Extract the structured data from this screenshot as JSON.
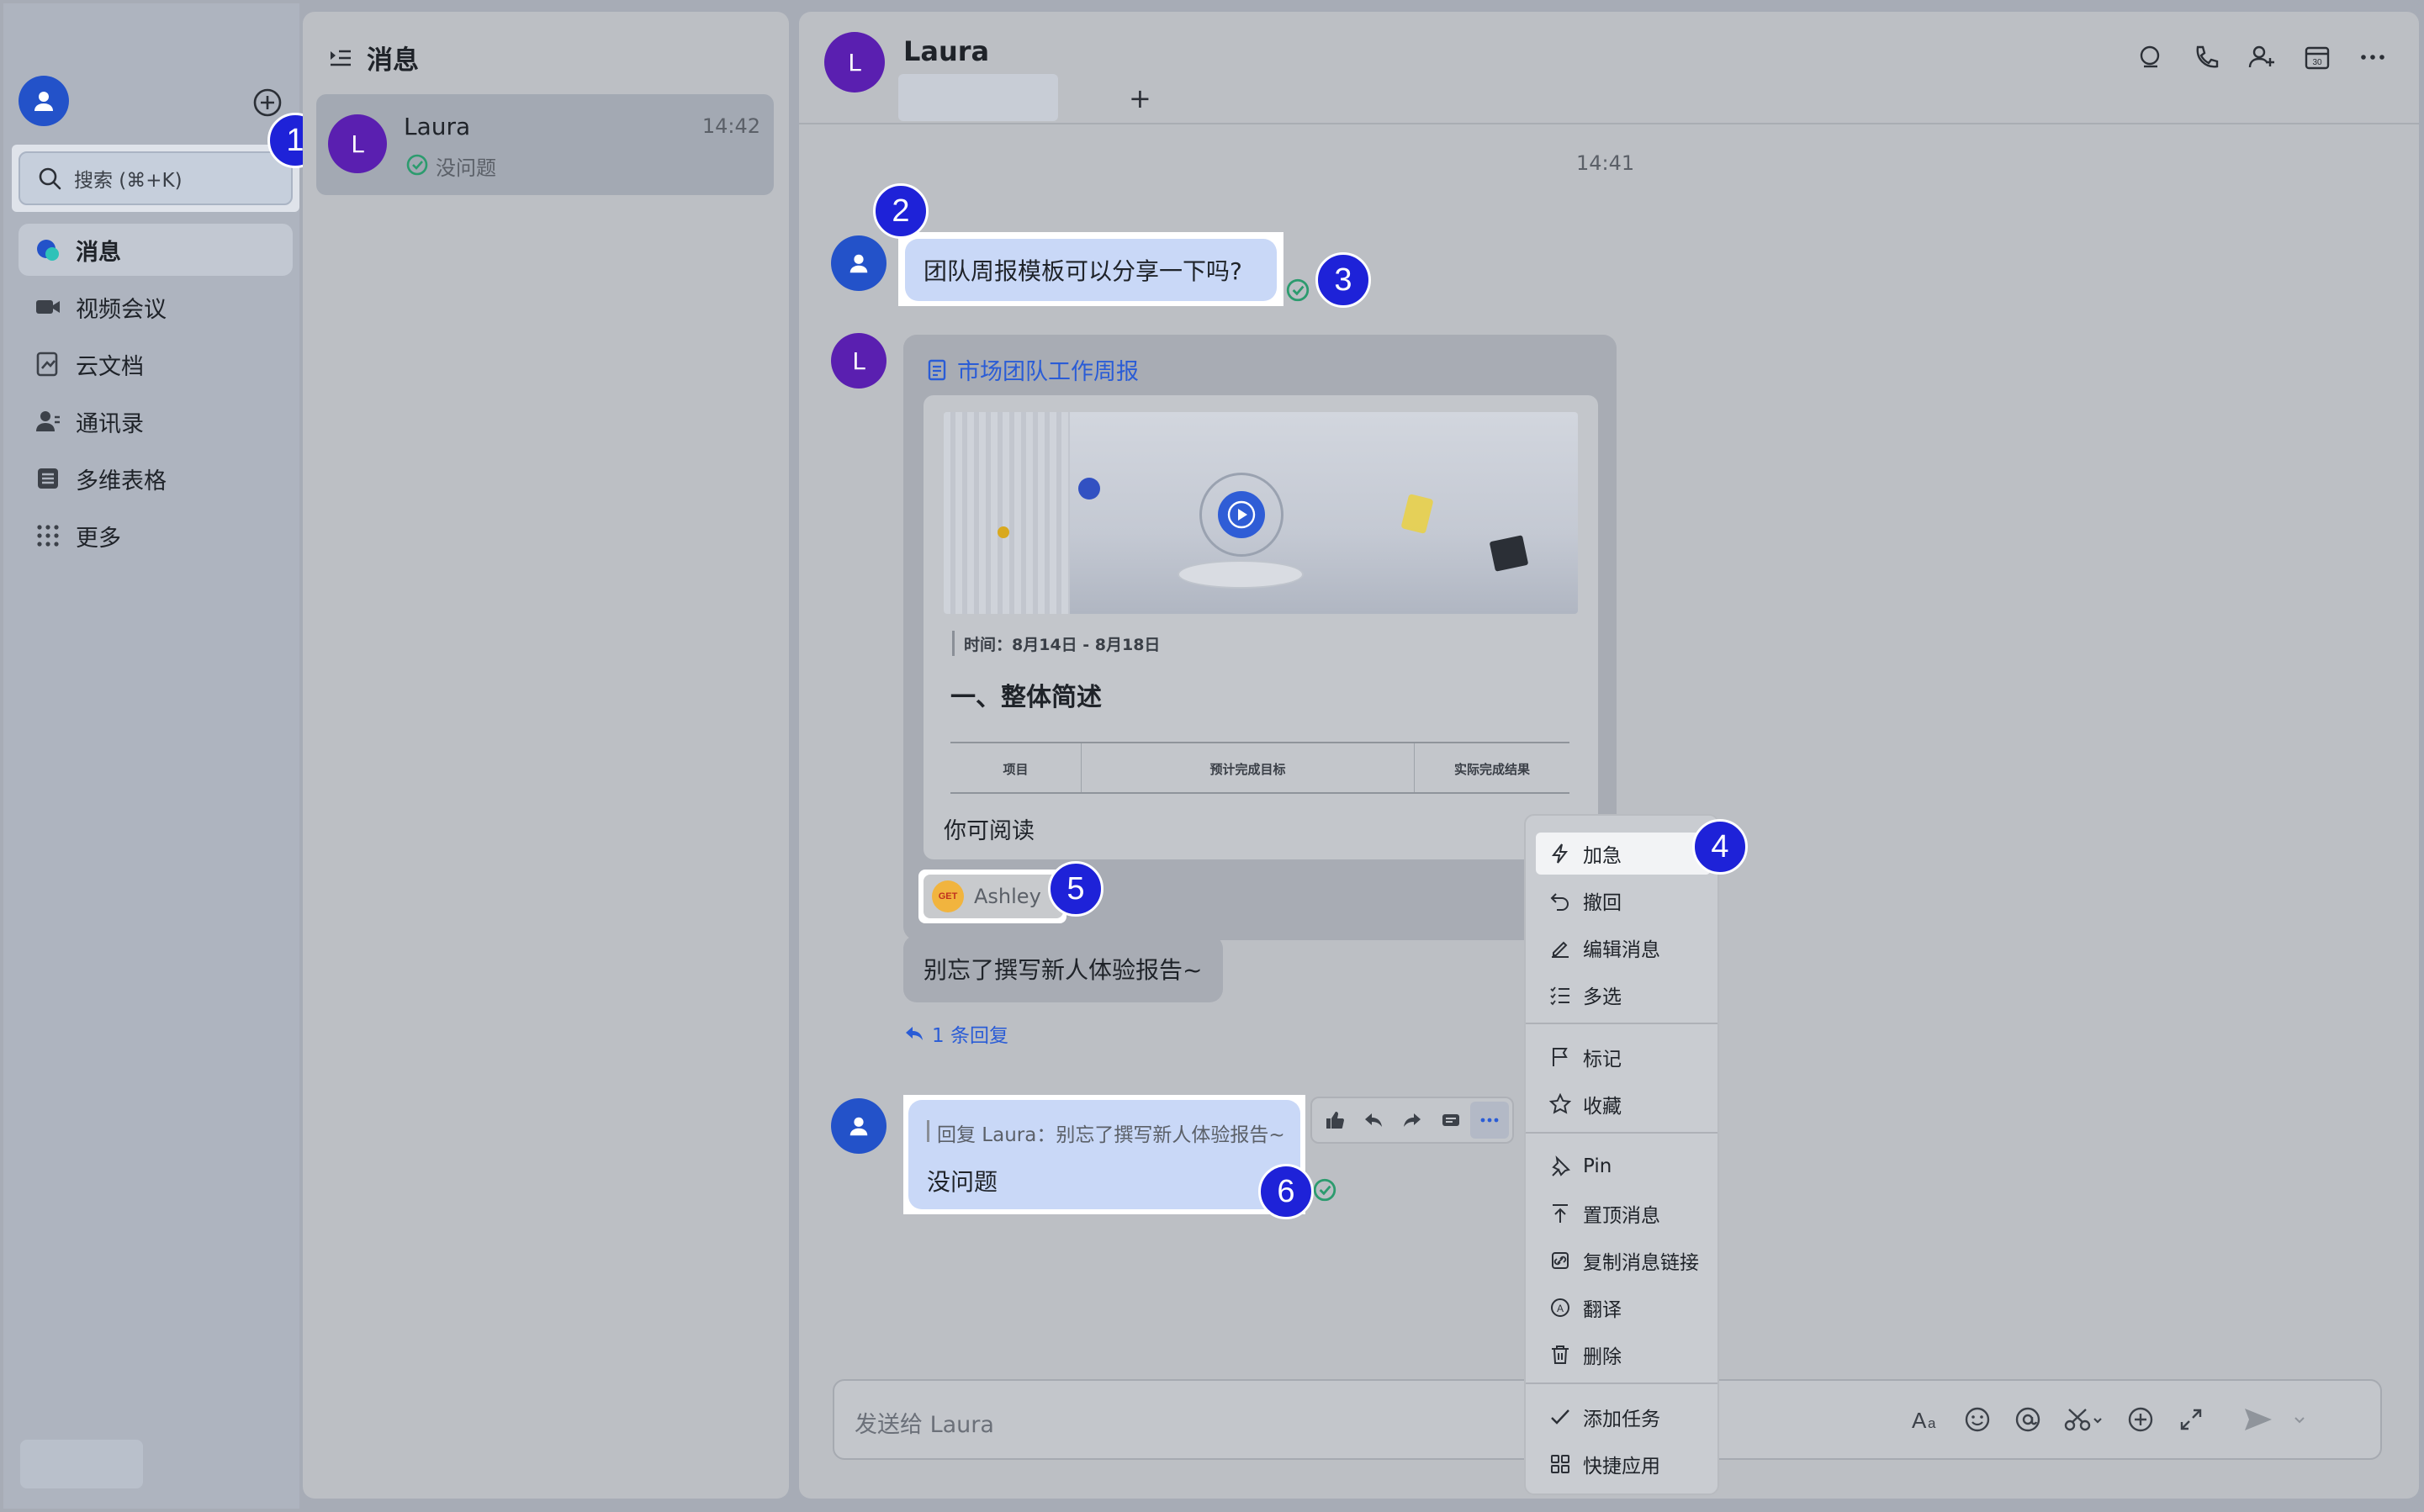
{
  "sidebar": {
    "search_placeholder": "搜索 (⌘+K)",
    "nav": [
      {
        "label": "消息",
        "icon": "message-icon",
        "active": true
      },
      {
        "label": "视频会议",
        "icon": "video-icon"
      },
      {
        "label": "云文档",
        "icon": "docs-icon"
      },
      {
        "label": "通讯录",
        "icon": "contacts-icon"
      },
      {
        "label": "多维表格",
        "icon": "base-icon"
      },
      {
        "label": "更多",
        "icon": "grid-icon"
      }
    ]
  },
  "chat_list": {
    "title": "消息",
    "items": [
      {
        "name": "Laura",
        "avatar_letter": "L",
        "time": "14:42",
        "preview": "没问题"
      }
    ]
  },
  "chat": {
    "contact_name": "Laura",
    "avatar_letter": "L",
    "add_tab": "+",
    "timestamp": "14:41",
    "message1": "团队周报模板可以分享一下吗?",
    "doc_card": {
      "title": "市场团队工作周报",
      "time_line": "时间：8月14日 - 8月18日",
      "heading": "一、整体简述",
      "table_headers": [
        "项目",
        "预计完成目标",
        "实际完成结果"
      ],
      "permission": "你可阅读"
    },
    "reaction_user": "Ashley",
    "reaction_sticker": "GET",
    "message2": "别忘了撰写新人体验报告~",
    "reply_count": "1 条回复",
    "reply_quote": "回复 Laura：别忘了撰写新人体验报告~",
    "reply_text": "没问题",
    "input_placeholder": "发送给 Laura"
  },
  "context_menu": {
    "items": [
      {
        "label": "加急",
        "icon": "bolt-icon"
      },
      {
        "label": "撤回",
        "icon": "undo-icon"
      },
      {
        "label": "编辑消息",
        "icon": "edit-icon"
      },
      {
        "label": "多选",
        "icon": "multiselect-icon"
      },
      {
        "label": "标记",
        "icon": "flag-icon"
      },
      {
        "label": "收藏",
        "icon": "star-icon"
      },
      {
        "label": "Pin",
        "icon": "pin-icon"
      },
      {
        "label": "置顶消息",
        "icon": "pin-top-icon"
      },
      {
        "label": "复制消息链接",
        "icon": "link-icon"
      },
      {
        "label": "翻译",
        "icon": "translate-icon"
      },
      {
        "label": "删除",
        "icon": "trash-icon"
      },
      {
        "label": "添加任务",
        "icon": "task-icon"
      },
      {
        "label": "快捷应用",
        "icon": "apps-icon"
      }
    ]
  },
  "annotations": [
    "1",
    "2",
    "3",
    "4",
    "5",
    "6"
  ],
  "colors": {
    "badge": "#1e22d8",
    "accent_link": "#2a5cd6",
    "read_check": "#2c9b6e",
    "avatar_purple": "#5a1fb0",
    "avatar_blue": "#2352c9"
  }
}
